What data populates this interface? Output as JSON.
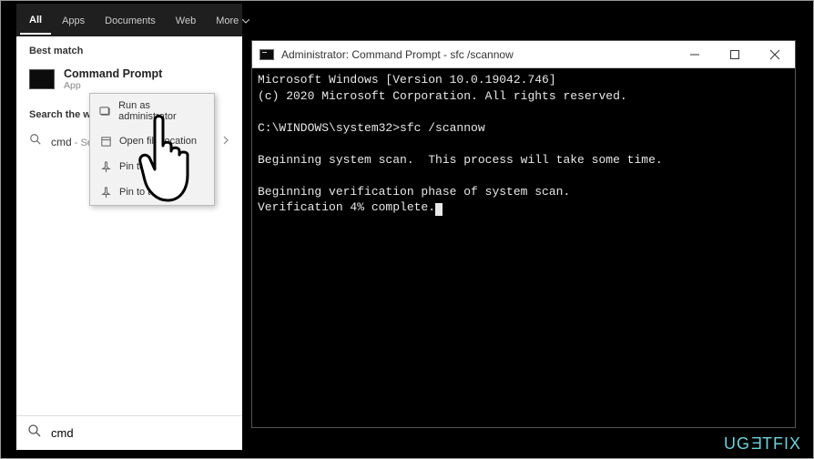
{
  "search": {
    "tabs": [
      "All",
      "Apps",
      "Documents",
      "Web",
      "More"
    ],
    "best_match_header": "Best match",
    "best_match": {
      "title": "Command Prompt",
      "sub": "App"
    },
    "web_header": "Search the web",
    "web_row": {
      "term": "cmd",
      "see": " - See web results"
    },
    "input_value": "cmd"
  },
  "context_menu": {
    "items": [
      {
        "label": "Run as administrator",
        "icon": "admin"
      },
      {
        "label": "Open file location",
        "icon": "folder"
      },
      {
        "label": "Pin to Start",
        "icon": "pin-start"
      },
      {
        "label": "Pin to taskbar",
        "icon": "pin-taskbar"
      }
    ]
  },
  "terminal": {
    "title": "Administrator: Command Prompt - sfc  /scannow",
    "lines": [
      "Microsoft Windows [Version 10.0.19042.746]",
      "(c) 2020 Microsoft Corporation. All rights reserved.",
      "",
      "C:\\WINDOWS\\system32>sfc /scannow",
      "",
      "Beginning system scan.  This process will take some time.",
      "",
      "Beginning verification phase of system scan.",
      "Verification 4% complete."
    ]
  },
  "watermark": "UGETFIX"
}
